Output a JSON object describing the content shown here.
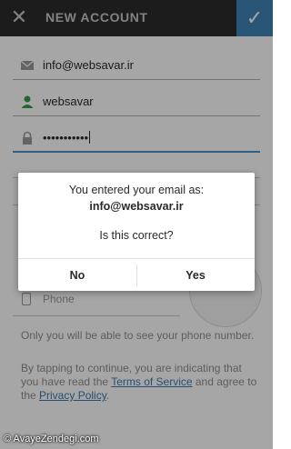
{
  "appbar": {
    "close_icon": "close-icon",
    "title": "NEW ACCOUNT",
    "confirm_icon": "checkmark-icon"
  },
  "form": {
    "email": {
      "icon": "envelope-icon",
      "value": "info@websavar.ir"
    },
    "username": {
      "icon": "person-icon",
      "value": "websavar"
    },
    "password": {
      "icon": "lock-icon",
      "value": "•••••••••••"
    },
    "phone": {
      "icon": "phone-icon",
      "placeholder": "Phone"
    }
  },
  "phone_note": "Only you will be able to see your phone number.",
  "terms": {
    "prefix": "By tapping to continue, you are indicating that you have read the ",
    "terms_link": "Terms of Service",
    "middle": " and agree to the ",
    "privacy_link": "Privacy Policy",
    "suffix": "."
  },
  "dialog": {
    "line1": "You entered your email as:",
    "email": "info@websavar.ir",
    "question": "Is this correct?",
    "no_label": "No",
    "yes_label": "Yes"
  },
  "watermark": "© AvayeZendegi.com",
  "colors": {
    "appbar_bg": "#2b2b2b",
    "accent": "#3f84b5",
    "link": "#3d78b0"
  }
}
